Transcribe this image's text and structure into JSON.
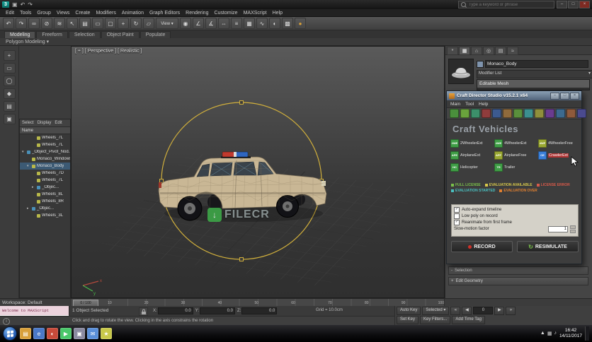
{
  "titlebar": {
    "search_placeholder": "Type a keyword or phrase",
    "logo_letter": "3",
    "quick_icons": [
      {
        "name": "save-icon",
        "glyph": "▣"
      },
      {
        "name": "undo-icon",
        "glyph": "↶"
      },
      {
        "name": "redo-icon",
        "glyph": "↷"
      }
    ],
    "window_buttons": [
      "–",
      "□",
      "×"
    ]
  },
  "menu_items": [
    "Edit",
    "Tools",
    "Group",
    "Views",
    "Create",
    "Modifiers",
    "Animation",
    "Graph Editors",
    "Rendering",
    "Customize",
    "MAXScript",
    "Help"
  ],
  "main_toolbar": {
    "icons": [
      {
        "name": "undo-icon",
        "glyph": "↶"
      },
      {
        "name": "redo-icon",
        "glyph": "↷"
      },
      {
        "name": "select-link-icon",
        "glyph": "∞"
      },
      {
        "name": "unlink-icon",
        "glyph": "⊘"
      },
      {
        "name": "bind-to-space-warp-icon",
        "glyph": "≋"
      },
      {
        "name": "select-object-icon",
        "glyph": "↖"
      },
      {
        "name": "select-by-name-icon",
        "glyph": "▤"
      },
      {
        "name": "selection-region-icon",
        "glyph": "▭"
      },
      {
        "name": "window-crossing-icon",
        "glyph": "▢"
      },
      {
        "name": "select-and-move-icon",
        "glyph": "+"
      },
      {
        "name": "select-and-rotate-icon",
        "glyph": "↻"
      },
      {
        "name": "select-and-scale-icon",
        "glyph": "▱"
      },
      {
        "name": "reference-coordinate-dropdown",
        "glyph": "View ▾",
        "wide": true
      },
      {
        "name": "use-pivot-center-icon",
        "glyph": "◉"
      },
      {
        "name": "snaps-toggle-icon",
        "glyph": "∠"
      },
      {
        "name": "angle-snap-icon",
        "glyph": "∡"
      },
      {
        "name": "mirror-icon",
        "glyph": "⇔"
      },
      {
        "name": "align-icon",
        "glyph": "≡"
      },
      {
        "name": "layer-manager-icon",
        "glyph": "▦"
      },
      {
        "name": "curve-editor-icon",
        "glyph": "∿"
      },
      {
        "name": "material-editor-icon",
        "glyph": "◐"
      },
      {
        "name": "render-setup-icon",
        "glyph": "▩"
      },
      {
        "name": "render-production-icon",
        "glyph": "●",
        "fg": "#d8a03a"
      }
    ]
  },
  "ribbon": {
    "tabs": [
      {
        "label": "Modeling",
        "active": true
      },
      {
        "label": "Freeform"
      },
      {
        "label": "Selection"
      },
      {
        "label": "Object Paint"
      },
      {
        "label": "Populate"
      }
    ],
    "panel_label": "Polygon Modeling ▾"
  },
  "left_toolbar": {
    "icons": [
      {
        "name": "create-geometry-icon",
        "glyph": "+"
      },
      {
        "name": "shapes-icon",
        "glyph": "▭"
      },
      {
        "name": "circle-icon",
        "glyph": "◯"
      },
      {
        "name": "modifier-icon",
        "glyph": "◆"
      },
      {
        "name": "list-icon",
        "glyph": "▤"
      },
      {
        "name": "grid-icon",
        "glyph": "▣"
      }
    ]
  },
  "explorer": {
    "menus": [
      "Select",
      "Display",
      "Edit"
    ],
    "name_header": "Name",
    "items": [
      {
        "arrow": "",
        "color": "#b8b84a",
        "label": "Wheels_7L",
        "depth": 2
      },
      {
        "arrow": "",
        "color": "#b8b84a",
        "label": "Wheels_7L",
        "depth": 2
      },
      {
        "arrow": "▾",
        "color": "#4a90b8",
        "label": "_Object_Pivot_Nod...",
        "depth": 0
      },
      {
        "arrow": "",
        "color": "#b8b84a",
        "label": "Monaco_Windows",
        "depth": 1
      },
      {
        "arrow": "▾",
        "color": "#b8b84a",
        "label": "Monaco_Body",
        "depth": 1,
        "selected": true
      },
      {
        "arrow": "",
        "color": "#b8b84a",
        "label": "Wheels_7D",
        "depth": 2
      },
      {
        "arrow": "",
        "color": "#b8b84a",
        "label": "Wheels_7L",
        "depth": 2
      },
      {
        "arrow": "▸",
        "color": "#4a90b8",
        "label": "_Objec...",
        "depth": 2
      },
      {
        "arrow": "",
        "color": "#b8b84a",
        "label": "Wheels_8L",
        "depth": 2
      },
      {
        "arrow": "",
        "color": "#b8b84a",
        "label": "Wheels_8R",
        "depth": 2
      },
      {
        "arrow": "▸",
        "color": "#4a90b8",
        "label": "_Objec...",
        "depth": 1
      },
      {
        "arrow": "",
        "color": "#b8b84a",
        "label": "Wheels_3L",
        "depth": 2
      }
    ]
  },
  "viewport": {
    "label": "[ + ] [ Perspective ] [ Realistic ]",
    "watermark_text": "FILECR",
    "watermark_arrow": "↓",
    "axis_x": "x",
    "axis_y": "y",
    "selection_color": "#cfae3c"
  },
  "command_panel": {
    "tabs": [
      {
        "name": "create-tab-icon",
        "glyph": "*"
      },
      {
        "name": "modify-tab-icon",
        "glyph": "▦",
        "active": true
      },
      {
        "name": "hierarchy-tab-icon",
        "glyph": "⌂"
      },
      {
        "name": "motion-tab-icon",
        "glyph": "◎"
      },
      {
        "name": "display-tab-icon",
        "glyph": "▤"
      },
      {
        "name": "utilities-tab-icon",
        "glyph": "≈"
      }
    ],
    "object_name": "Monaco_Body",
    "modifier_list_label": "Modifier List",
    "dropdown_arrow": "▾",
    "stack": [
      {
        "label": "Editable Mesh",
        "selected": true
      }
    ],
    "rollouts": [
      {
        "prefix": "-",
        "label": "Selection"
      },
      {
        "prefix": "+",
        "label": "Edit Geometry"
      }
    ]
  },
  "craft": {
    "title": "Craft Director Studio v15.2.1 x64",
    "menus": [
      "Main",
      "Tool",
      "Help"
    ],
    "window_buttons": [
      "–",
      "□",
      "×"
    ],
    "toolbar_colors": [
      "#4a8f3c",
      "#6aa33c",
      "#3c8f6a",
      "#8f3c3c",
      "#3c5a8f",
      "#8f6a3c",
      "#5a8f3c",
      "#3c8f8f",
      "#8f8f3c",
      "#6a3c8f",
      "#3c6a8f",
      "#8f5a3c",
      "#4a4a8f"
    ],
    "header": "Craft Vehicles",
    "items": [
      {
        "code": "2WE",
        "label": "2WheelerExt",
        "icon_color": "#3f9e46"
      },
      {
        "code": "4WE",
        "label": "4WheelerExt",
        "icon_color": "#3f9e46"
      },
      {
        "code": "4WF",
        "label": "4WheelerFree",
        "icon_color": "#9aa832"
      },
      {
        "code": "APE",
        "label": "AirplaneExt",
        "icon_color": "#3f9e46"
      },
      {
        "code": "APF",
        "label": "AirplaneFree",
        "icon_color": "#9aa832"
      },
      {
        "code": "CE",
        "label": "CrawlerExt",
        "icon_color": "#3a7fd8",
        "selected": true
      },
      {
        "code": "HC",
        "label": "Helicopter",
        "icon_color": "#3f9e46"
      },
      {
        "code": "TR",
        "label": "Trailer",
        "icon_color": "#3f9e46"
      }
    ],
    "legend": [
      {
        "label": "FULL LICENSE",
        "color": "#7ac04a"
      },
      {
        "label": "EVALUATION AVAILABLE",
        "color": "#d8c84a"
      },
      {
        "label": "LICENSE ERROR",
        "color": "#d85a4a"
      },
      {
        "label": "EVALUATION STARTED",
        "color": "#4ac0c0"
      },
      {
        "label": "EVALUATION OVER",
        "color": "#e08030"
      }
    ],
    "options": [
      {
        "label": "Auto-expand timeline",
        "checked": true
      },
      {
        "label": "Low poly on record",
        "checked": false
      },
      {
        "label": "Reanimate from first frame",
        "checked": true
      }
    ],
    "slow_motion_label": "Slow-motion factor",
    "slow_motion_value": "1",
    "record_label": "RECORD",
    "resimulate_label": "RESIMULATE"
  },
  "timeline": {
    "workspace_label": "Workspace: Default",
    "slider_label": "0 / 100",
    "ticks": [
      "0",
      "10",
      "20",
      "30",
      "40",
      "50",
      "60",
      "70",
      "80",
      "90",
      "100"
    ]
  },
  "status": {
    "listener_text": "Welcome to MAXScript",
    "selection_text": "1 Object Selected",
    "coords": [
      {
        "label": "X:",
        "value": "0.0"
      },
      {
        "label": "Y:",
        "value": "0.0"
      },
      {
        "label": "Z:",
        "value": "0.0"
      }
    ],
    "grid_label": "Grid = 10.0cm",
    "prompt": "Click and drag to rotate the view. Clicking in the axis constrains the rotation",
    "auto_key": "Auto Key",
    "selected_filter": "Selected ▾",
    "set_key": "Set Key",
    "key_filters": "Key Filters...",
    "add_time_tag": "Add Time Tag",
    "frame_value": "0",
    "playback": {
      "prev": "«",
      "back": "◀",
      "play": "▶",
      "next": "»"
    },
    "nav_icons": [
      {
        "name": "zoom-icon",
        "glyph": "⊕"
      },
      {
        "name": "zoom-all-icon",
        "glyph": "▭"
      },
      {
        "name": "zoom-extents-icon",
        "glyph": "◎"
      },
      {
        "name": "zoom-region-icon",
        "glyph": "◱"
      },
      {
        "name": "pan-icon",
        "glyph": "+"
      },
      {
        "name": "orbit-icon",
        "glyph": "↻"
      },
      {
        "name": "maximize-viewport-icon",
        "glyph": "▣"
      },
      {
        "name": "field-of-view-icon",
        "glyph": "▽"
      }
    ]
  },
  "taskbar": {
    "icons": [
      {
        "name": "explorer-icon",
        "color": "#d8a03a",
        "glyph": "▤"
      },
      {
        "name": "browser-icon",
        "color": "#4a78c8",
        "glyph": "e"
      },
      {
        "name": "media-icon",
        "color": "#c84a3a",
        "glyph": "◐"
      },
      {
        "name": "player-icon",
        "color": "#4ac86a",
        "glyph": "▶"
      },
      {
        "name": "app-icon",
        "color": "#8a8aa0",
        "glyph": "▣"
      },
      {
        "name": "mail-icon",
        "color": "#5a8fd8",
        "glyph": "✉"
      },
      {
        "name": "star-icon",
        "color": "#c8c84a",
        "glyph": "★"
      }
    ],
    "tray_icons": [
      {
        "name": "show-hidden-icons",
        "glyph": "▲"
      },
      {
        "name": "network-icon",
        "glyph": "▦"
      },
      {
        "name": "volume-icon",
        "glyph": "♪"
      }
    ],
    "clock_time": "16:42",
    "clock_date": "14/11/2017"
  }
}
